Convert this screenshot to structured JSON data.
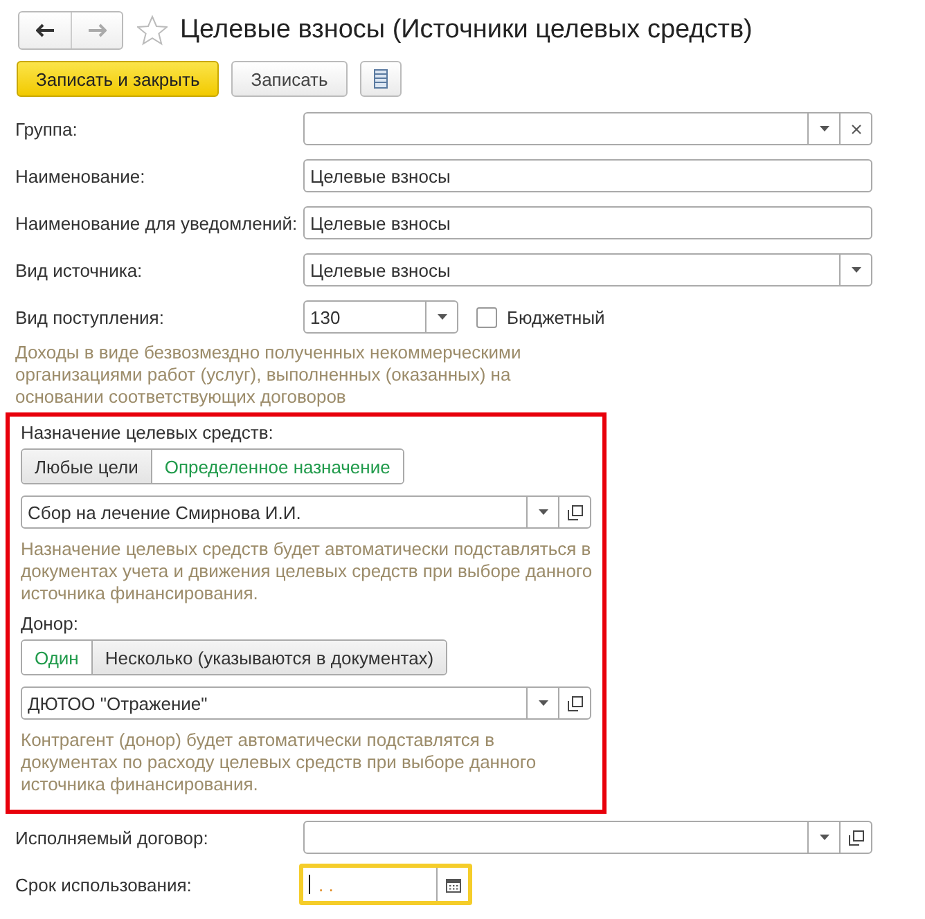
{
  "window": {
    "title": "Целевые взносы (Источники целевых средств)",
    "favorite": false
  },
  "nav": {
    "back_disabled": false,
    "forward_disabled": true
  },
  "toolbar": [
    {
      "kind": "primary",
      "label": "Записать и закрыть"
    },
    {
      "kind": "default",
      "label": "Записать"
    },
    {
      "kind": "menu"
    }
  ],
  "fields": [
    {
      "label": "Группа:",
      "kind": "select-clear"
    },
    {
      "label": "Наименование:",
      "kind": "text",
      "value": "Целевые взносы"
    },
    {
      "label": "Наименование для уведомлений:",
      "kind": "text",
      "value": "Целевые взносы"
    },
    {
      "label": "Вид источника:",
      "kind": "select",
      "value": "Целевые взносы"
    },
    {
      "label": "Вид поступления:",
      "kind": "short-select",
      "value": "130",
      "checkbox": {
        "label": "Бюджетный",
        "checked": false
      }
    }
  ],
  "income_note": "Доходы в виде безвозмездно полученных некоммерческими организациями работ (услуг), выполненных (оказанных) на основании соответствующих договоров",
  "highlighted": true,
  "groups": [
    {
      "label": "Назначение целевых средств:",
      "options": [
        {
          "label": "Любые цели",
          "selected": false
        },
        {
          "label": "Определенное назначение",
          "selected": true
        }
      ],
      "value": "Сбор на лечение Смирнова И.И.",
      "note": "Назначение целевых средств будет автоматически подставляться в документах учета и движения целевых средств при выборе данного источника финансирования."
    },
    {
      "label": "Донор:",
      "options": [
        {
          "label": "Один",
          "selected": true
        },
        {
          "label": "Несколько (указываются в документах)",
          "selected": false
        }
      ],
      "value": "ДЮТОО \"Отражение\"",
      "note": "Контрагент (донор) будет автоматически подставлятся в документах по расходу целевых средств при выборе данного источника финансирования."
    }
  ],
  "contract": {
    "label": "Исполняемый договор:"
  },
  "usage_term": {
    "label": "Срок использования:",
    "value": ".  .",
    "focused": true
  }
}
